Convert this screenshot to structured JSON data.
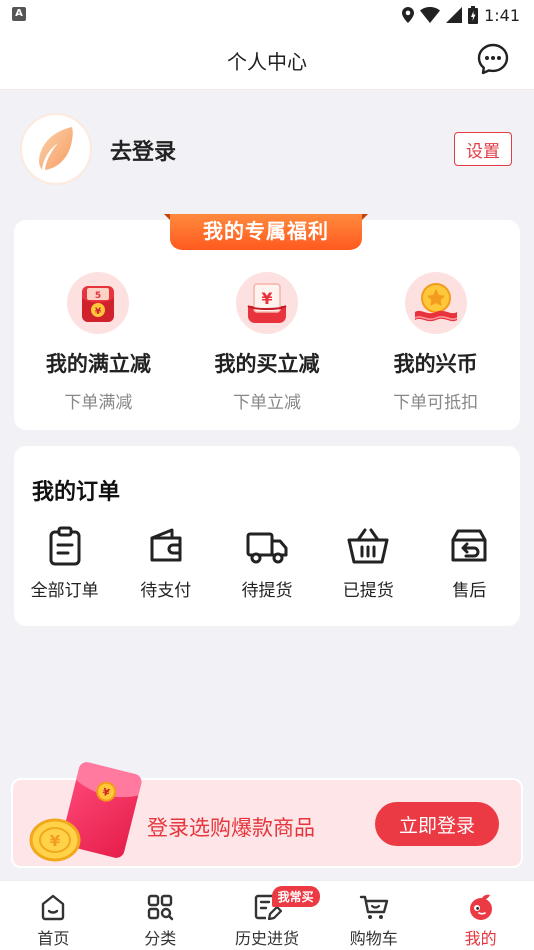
{
  "status_bar": {
    "time": "1:41"
  },
  "header": {
    "title": "个人中心"
  },
  "user": {
    "login_label": "去登录",
    "settings_label": "设置"
  },
  "benefits": {
    "banner": "我的专属福利",
    "items": [
      {
        "title": "我的满立减",
        "subtitle": "下单满减",
        "icon": "red-envelope-icon"
      },
      {
        "title": "我的买立减",
        "subtitle": "下单立减",
        "icon": "yen-coupon-icon"
      },
      {
        "title": "我的兴币",
        "subtitle": "下单可抵扣",
        "icon": "gold-coin-icon"
      }
    ]
  },
  "orders": {
    "title": "我的订单",
    "items": [
      {
        "label": "全部订单",
        "icon": "clipboard-icon"
      },
      {
        "label": "待支付",
        "icon": "wallet-icon"
      },
      {
        "label": "待提货",
        "icon": "truck-icon"
      },
      {
        "label": "已提货",
        "icon": "basket-icon"
      },
      {
        "label": "售后",
        "icon": "return-box-icon"
      }
    ]
  },
  "promo": {
    "text": "登录选购爆款商品",
    "button": "立即登录"
  },
  "tabbar": {
    "items": [
      {
        "label": "首页",
        "icon": "home-icon"
      },
      {
        "label": "分类",
        "icon": "category-grid-icon"
      },
      {
        "label": "历史进货",
        "icon": "history-note-icon",
        "badge": "我常买"
      },
      {
        "label": "购物车",
        "icon": "cart-icon"
      },
      {
        "label": "我的",
        "icon": "profile-mascot-icon",
        "active": true
      }
    ]
  },
  "colors": {
    "accent": "#ec3a44",
    "banner": "#ff6a2a",
    "background": "#f1f1f6"
  }
}
